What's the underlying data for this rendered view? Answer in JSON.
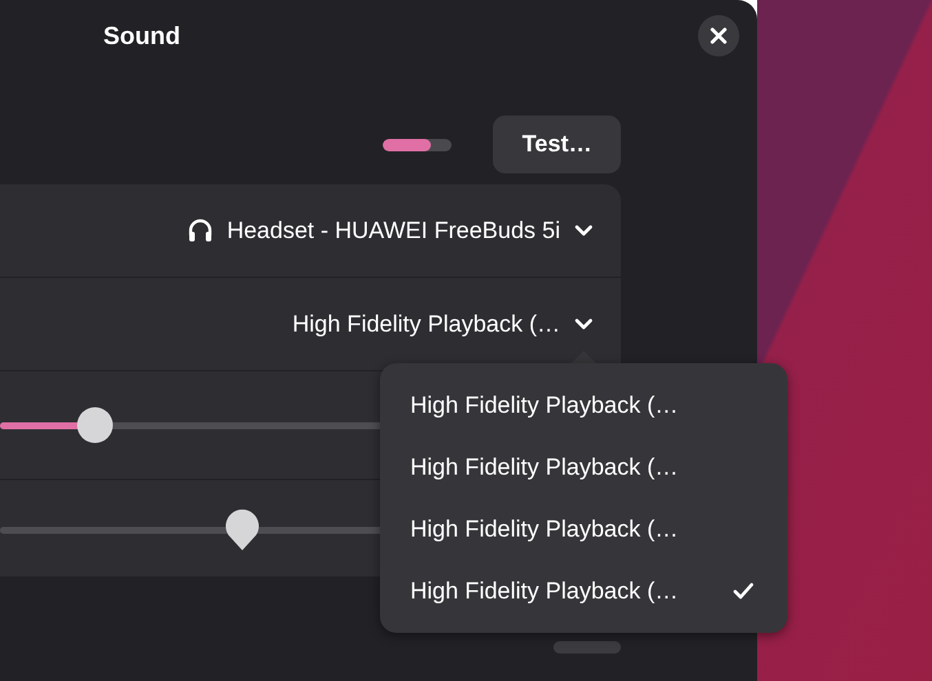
{
  "window": {
    "title": "Sound"
  },
  "output": {
    "level": 0.7,
    "test_button": "Test…"
  },
  "device_row": {
    "device": "Headset - HUAWEI FreeBuds 5i"
  },
  "profile_row": {
    "profile": "High Fidelity Playback (…",
    "expanded": true
  },
  "sliders": [
    {
      "kind": "fill",
      "level": 0.16
    },
    {
      "kind": "pin",
      "level": 0.41
    }
  ],
  "profile_menu": {
    "items": [
      {
        "label": "High Fidelity Playback (…",
        "selected": false
      },
      {
        "label": "High Fidelity Playback (…",
        "selected": false
      },
      {
        "label": "High Fidelity Playback (…",
        "selected": false
      },
      {
        "label": "High Fidelity Playback (…",
        "selected": true
      }
    ]
  }
}
